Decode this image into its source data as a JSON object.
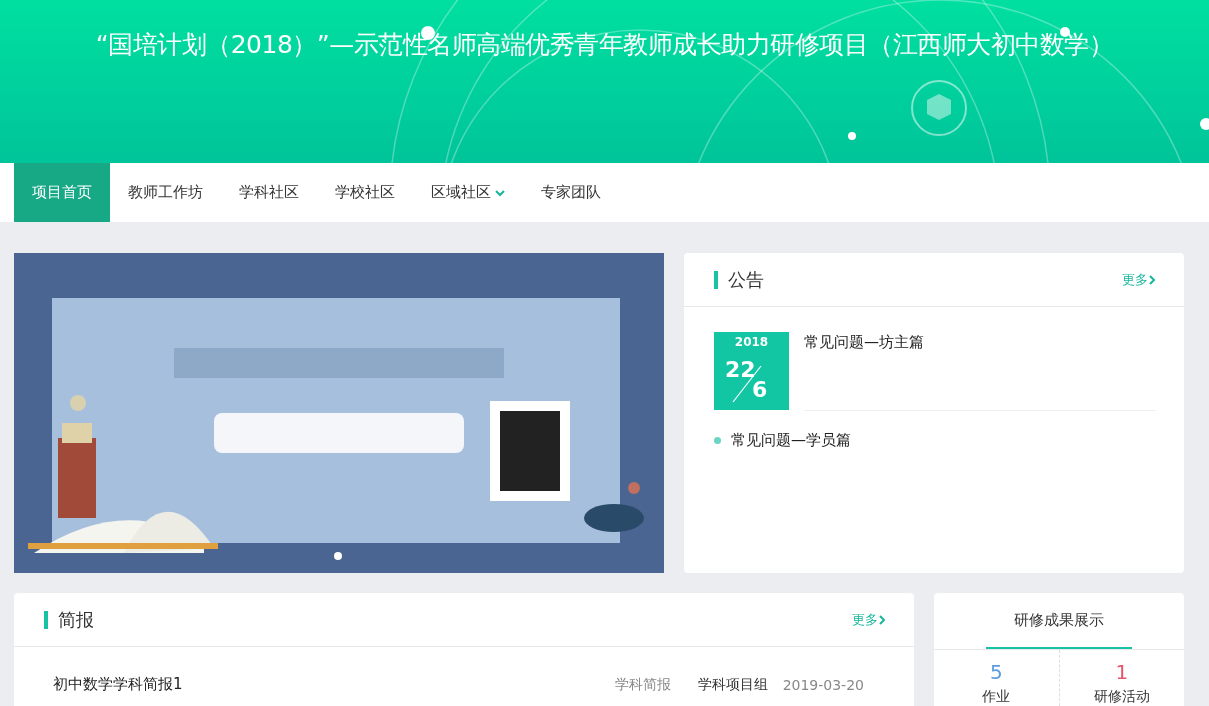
{
  "header": {
    "title": "“国培计划（2018）”—示范性名师高端优秀青年教师成长助力研修项目（江西师大初中数学）"
  },
  "nav": [
    {
      "label": "项目首页",
      "selected": true
    },
    {
      "label": "教师工作坊",
      "selected": false
    },
    {
      "label": "学科社区",
      "selected": false
    },
    {
      "label": "学校社区",
      "selected": false
    },
    {
      "label": "区域社区",
      "selected": false,
      "dropdown": true
    },
    {
      "label": "专家团队",
      "selected": false
    }
  ],
  "banner": {
    "dots": [
      {
        "selected": true
      }
    ]
  },
  "notices": {
    "title": "公告",
    "more": "更多",
    "featured": {
      "year": "2018",
      "day": "22",
      "month": "6",
      "title": "常见问题—坊主篇"
    },
    "items": [
      "常见问题—学员篇"
    ]
  },
  "briefings": {
    "title": "简报",
    "more": "更多",
    "rows": [
      {
        "title": "初中数学学科简报1",
        "category": "学科简报",
        "author": "学科项目组",
        "date": "2019-03-20"
      }
    ]
  },
  "results": {
    "title": "研修成果展示",
    "stats": [
      {
        "value": "5",
        "label": "作业",
        "color": "#5b9be0"
      },
      {
        "value": "1",
        "label": "研修活动",
        "color": "#e8546a"
      }
    ]
  }
}
